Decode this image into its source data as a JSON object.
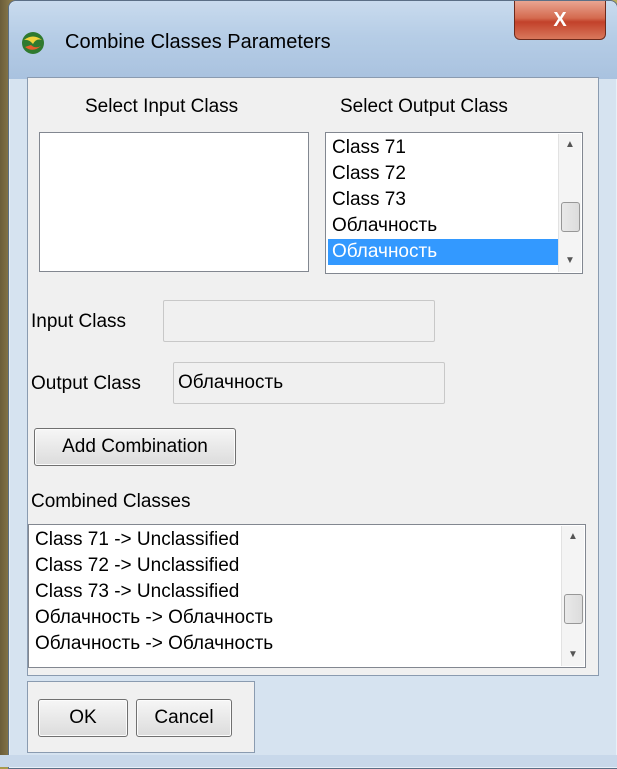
{
  "window": {
    "title": "Combine Classes Parameters",
    "close_label": "X"
  },
  "input_list": {
    "label": "Select Input Class",
    "items": []
  },
  "output_list": {
    "label": "Select Output Class",
    "items": [
      "Class 71",
      "Class 72",
      "Class 73",
      "Облачность",
      "Облачность"
    ],
    "selected_index": 4
  },
  "input_class": {
    "label": "Input Class",
    "value": ""
  },
  "output_class": {
    "label": "Output Class",
    "value": "Облачность"
  },
  "add_button": {
    "label": "Add Combination"
  },
  "combined": {
    "label": "Combined Classes",
    "items": [
      "Class 71 -> Unclassified",
      "Class 72 -> Unclassified",
      "Class 73 -> Unclassified",
      "Облачность -> Облачность",
      "Облачность -> Облачность"
    ]
  },
  "buttons": {
    "ok": "OK",
    "cancel": "Cancel"
  },
  "icons": {
    "app": "globe-icon",
    "scroll_up": "chevron-up-icon",
    "scroll_down": "chevron-down-icon",
    "close": "close-icon"
  },
  "colors": {
    "selection": "#3399ff",
    "close_button": "#c2412a",
    "titlebar": "#b6cde6"
  }
}
